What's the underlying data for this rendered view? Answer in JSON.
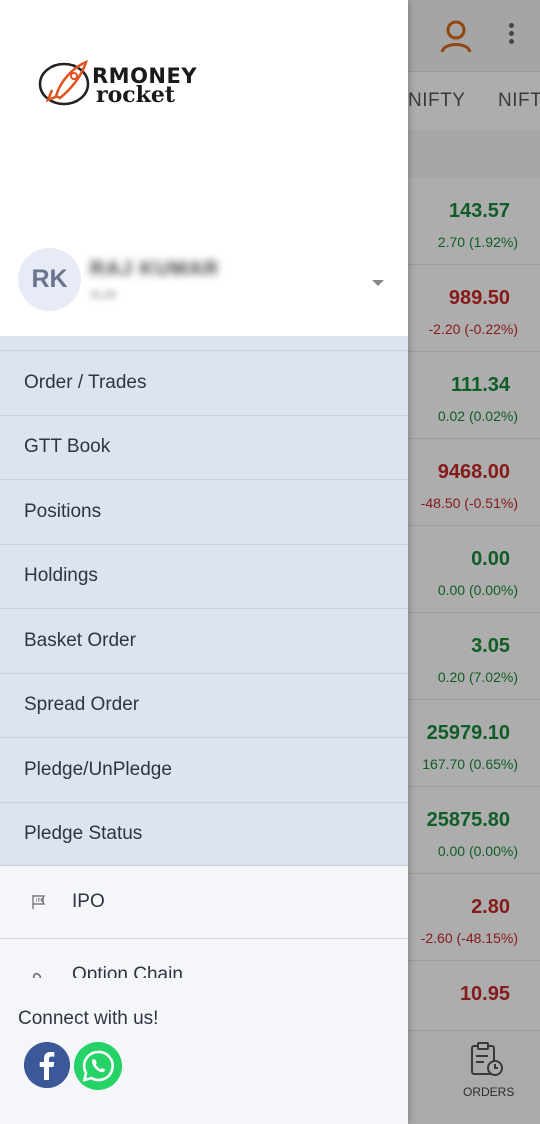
{
  "background": {
    "tabs": [
      "NIFTY",
      "NIFT"
    ],
    "rows": [
      {
        "price": "143.57",
        "change": "2.70 (1.92%)",
        "trend": "up"
      },
      {
        "price": "989.50",
        "change": "-2.20 (-0.22%)",
        "trend": "down"
      },
      {
        "price": "111.34",
        "change": "0.02 (0.02%)",
        "trend": "up"
      },
      {
        "price": "9468.00",
        "change": "-48.50 (-0.51%)",
        "trend": "down"
      },
      {
        "price": "0.00",
        "change": "0.00 (0.00%)",
        "trend": "up"
      },
      {
        "price": "3.05",
        "change": "0.20 (7.02%)",
        "trend": "up"
      },
      {
        "price": "25979.10",
        "change": "167.70 (0.65%)",
        "trend": "up"
      },
      {
        "price": "25875.80",
        "change": "0.00 (0.00%)",
        "trend": "up"
      },
      {
        "price": "2.80",
        "change": "-2.60 (-48.15%)",
        "trend": "down"
      },
      {
        "price": "10.95",
        "change": "",
        "trend": "down"
      }
    ],
    "orders_label": "ORDERS"
  },
  "drawer": {
    "logo": {
      "line1": "RMONEY",
      "line2": "rocket"
    },
    "user": {
      "initials": "RK",
      "name": "RAJ KUMAR",
      "sub": "XLRI"
    },
    "menu": [
      "Order / Trades",
      "GTT Book",
      "Positions",
      "Holdings",
      "Basket Order",
      "Spread Order",
      "Pledge/UnPledge",
      "Pledge Status"
    ],
    "extra": [
      {
        "label": "IPO",
        "icon": "ipo-icon"
      },
      {
        "label": "Option Chain",
        "icon": "option-chain-icon"
      }
    ],
    "connect": {
      "title": "Connect with us!"
    }
  },
  "colors": {
    "up": "#1a8a3a",
    "down": "#c62828",
    "menu_bg": "#dde3ef",
    "accent": "#e0531f"
  }
}
